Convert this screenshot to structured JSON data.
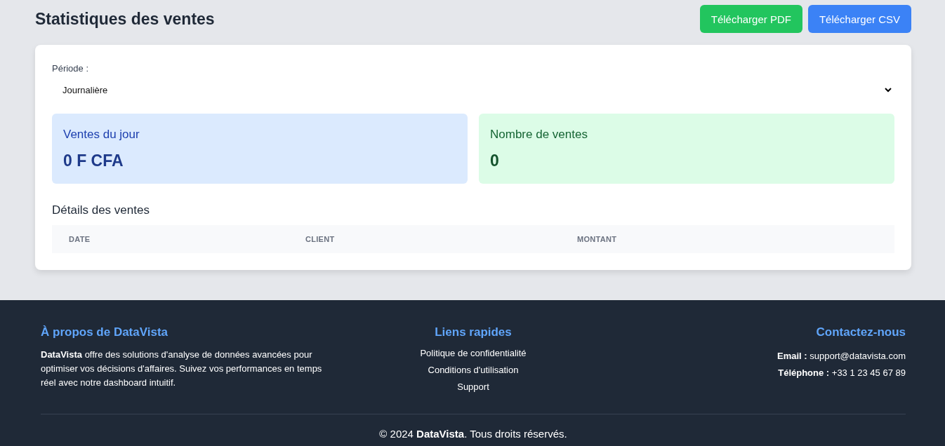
{
  "page_title": "Statistiques des ventes",
  "buttons": [
    {
      "label": "Télécharger PDF",
      "kind": "pdf"
    },
    {
      "label": "Télécharger CSV",
      "kind": "csv"
    }
  ],
  "period": {
    "label": "Période :",
    "value": "Journalière"
  },
  "stats": [
    {
      "title": "Ventes du jour",
      "value": "0 F CFA",
      "kind": "revenue"
    },
    {
      "title": "Nombre de ventes",
      "value": "0",
      "kind": "count"
    }
  ],
  "details": {
    "title": "Détails des ventes",
    "columns": [
      "DATE",
      "CLIENT",
      "MONTANT"
    ]
  },
  "footer": {
    "about": {
      "title": "À propos de DataVista",
      "text": "**DataVista** offre des solutions d'analyse de données avancées pour optimiser vos décisions d'affaires. Suivez vos performances en temps réel avec notre dashboard intuitif."
    },
    "links": {
      "title": "Liens rapides",
      "items": [
        "Politique de confidentialité",
        "Conditions d'utilisation",
        "Support"
      ]
    },
    "contact": {
      "title": "Contactez-nous",
      "lines": [
        {
          "label": "Email :",
          "value": "support@datavista.com"
        },
        {
          "label": "Téléphone :",
          "value": "+33 1 23 45 67 89"
        }
      ]
    },
    "copyright": "© 2024 **DataVista**. Tous droits réservés."
  }
}
